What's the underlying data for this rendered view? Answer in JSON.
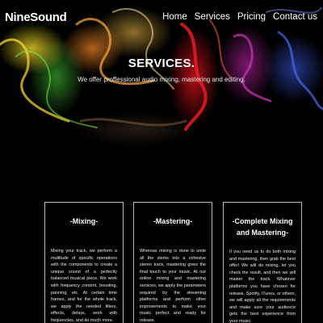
{
  "header": {
    "logo": "NineSound",
    "nav": [
      "Home",
      "Services",
      "Pricing",
      "Contact us"
    ]
  },
  "hero": {
    "title": "SERVICES.",
    "subtitle": "We offer proffessional audio mixing, mastering and editing."
  },
  "services": [
    {
      "title": "-Mixing-",
      "body": "Mixing your track, we perform a multitude of specific operations with the components to create a unique sound of a perfectly balanced musical piece. We work with frequency content, boosting, panning, etc. At certain time frames, and for the whole track, we apply the needed filters, effects, delays, work with frequencies, and do much more."
    },
    {
      "title": "-Mastering-",
      "body": "Whereas mixing is done to unite all the stems into a cohesive stereo track, mastering gives the final touch to your music. At our online mixing and mastering services, we apply the parameters required by the streaming platforms and perform other improvements to make your music perfect and ready for release."
    },
    {
      "title": "-Complete Mixing and Mastering-",
      "body": "If you need us to do both mixing and mastering, then grab the best offer! We will do mixing, let you check the result, and then we will master the track. Whatever platforms you have chosen for release, Spotify, iTunes, or others, we will apply all the requirements and make sure your audience gets the best experience from your music."
    }
  ],
  "colors": {
    "background": "#000000",
    "text": "#ffffff",
    "card_border": "#bbbbbb"
  }
}
